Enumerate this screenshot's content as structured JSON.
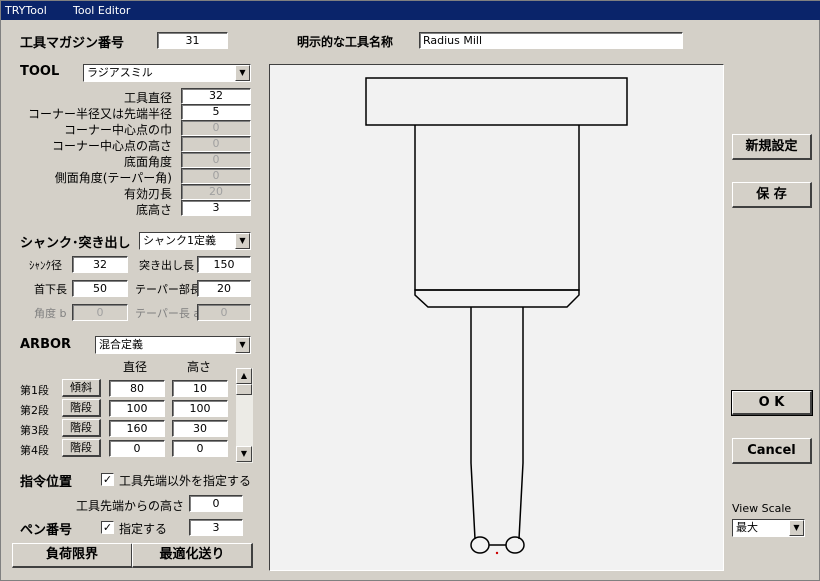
{
  "titlebar": {
    "app": "TRYTool",
    "window": "Tool Editor"
  },
  "header": {
    "magazine_label": "工具マガジン番号",
    "magazine_value": "31",
    "explicit_name_label": "明示的な工具名称",
    "explicit_name_value": "Radius Mill"
  },
  "tool": {
    "label": "TOOL",
    "selected": "ラジアスミル",
    "params": [
      {
        "label": "工具直径",
        "value": "32",
        "disabled": false
      },
      {
        "label": "コーナー半径又は先端半径",
        "value": "5",
        "disabled": false
      },
      {
        "label": "コーナー中心点の巾",
        "value": "0",
        "disabled": true
      },
      {
        "label": "コーナー中心点の高さ",
        "value": "0",
        "disabled": true
      },
      {
        "label": "底面角度",
        "value": "0",
        "disabled": true
      },
      {
        "label": "側面角度(テーパー角)",
        "value": "0",
        "disabled": true
      },
      {
        "label": "有効刃長",
        "value": "20",
        "disabled": true
      },
      {
        "label": "底高さ",
        "value": "3",
        "disabled": false
      }
    ]
  },
  "shank": {
    "label": "シャンク･突き出し",
    "selected": "シャンク1定義",
    "diameter_label": "ｼｬﾝｸ径",
    "diameter_value": "32",
    "protrusion_label": "突き出し長",
    "protrusion_value": "150",
    "neck_label": "首下長",
    "neck_value": "50",
    "taper_part_label": "テーパー部長",
    "taper_part_value": "20",
    "angle_label": "角度 b",
    "angle_value": "0",
    "taper_len_label": "テーパー長 a",
    "taper_len_value": "0"
  },
  "arbor": {
    "label": "ARBOR",
    "selected": "混合定義",
    "col_diameter": "直径",
    "col_height": "高さ",
    "rows": [
      {
        "stage": "第1段",
        "type": "傾斜",
        "diameter": "80",
        "height": "10"
      },
      {
        "stage": "第2段",
        "type": "階段",
        "diameter": "100",
        "height": "100"
      },
      {
        "stage": "第3段",
        "type": "階段",
        "diameter": "160",
        "height": "30"
      },
      {
        "stage": "第4段",
        "type": "階段",
        "diameter": "0",
        "height": "0"
      }
    ]
  },
  "command": {
    "label": "指令位置",
    "checkbox_label": "工具先端以外を指定する",
    "height_label": "工具先端からの高さ",
    "height_value": "0"
  },
  "pen": {
    "label": "ペン番号",
    "checkbox_label": "指定する",
    "value": "3"
  },
  "bottom_buttons": {
    "load_limit": "負荷限界",
    "optimize": "最適化送り"
  },
  "right_buttons": {
    "new": "新規設定",
    "save": "保 存",
    "ok": "O K",
    "cancel": "Cancel"
  },
  "view_scale": {
    "label": "View Scale",
    "selected": "最大"
  },
  "colors": {
    "titlebar": "#0a246a",
    "face": "#d4d0c8",
    "canvas": "#f2f2f2",
    "tip_marker": "#cc0000"
  }
}
